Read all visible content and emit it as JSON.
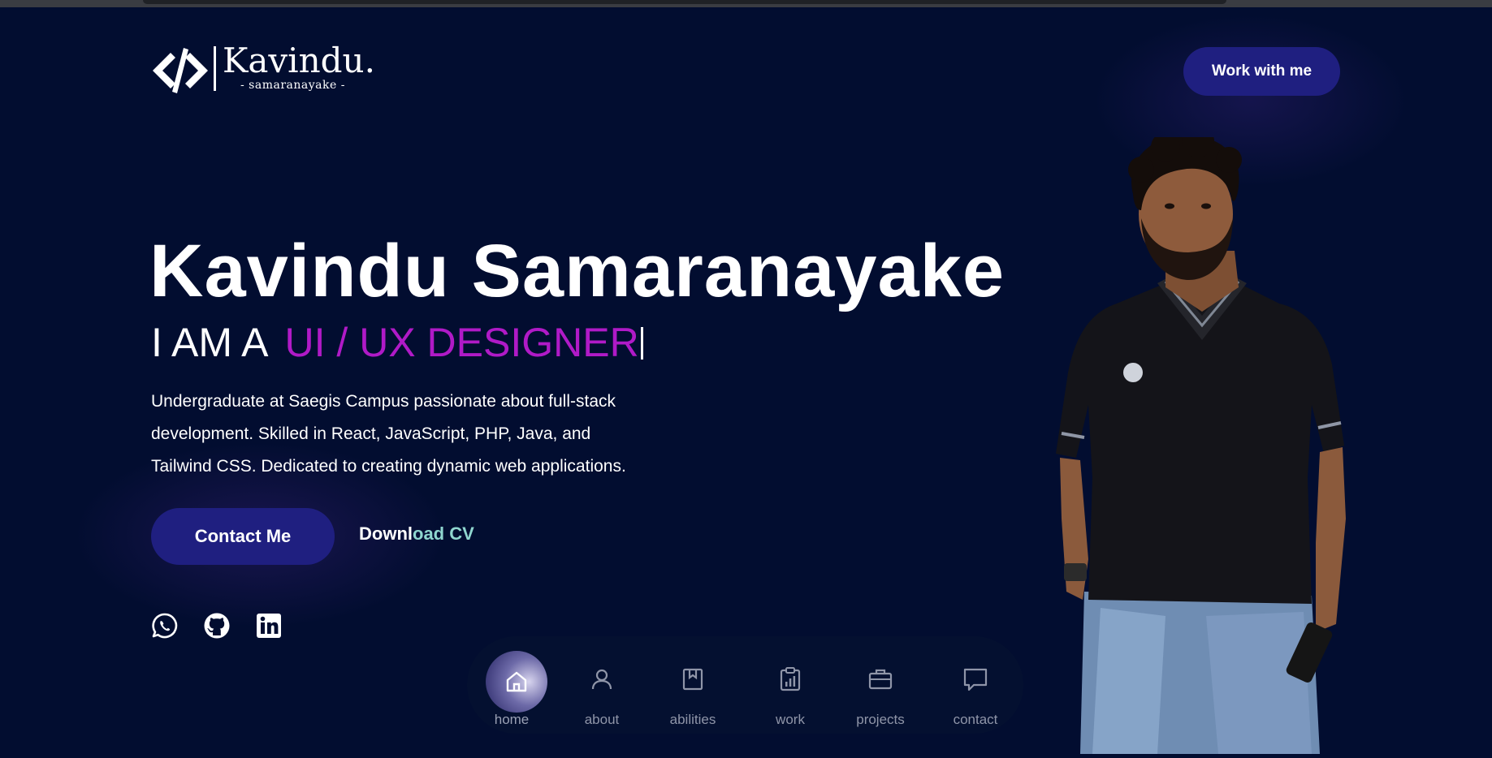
{
  "header": {
    "logo_name": "Kavindu.",
    "logo_sub": "- samaranayake -",
    "cta_label": "Work with me"
  },
  "hero": {
    "name": "Kavindu Samaranayake",
    "role_prefix": "I AM A",
    "role_value": "UI / UX DESIGNER",
    "bio": "Undergraduate at Saegis Campus passionate about full-stack development. Skilled in React, JavaScript, PHP, Java, and Tailwind CSS. Dedicated to creating dynamic web applications.",
    "contact_label": "Contact Me",
    "cv_label_a": "Downl",
    "cv_label_b": "oad CV"
  },
  "social": [
    {
      "icon": "whatsapp-icon"
    },
    {
      "icon": "github-icon"
    },
    {
      "icon": "linkedin-icon"
    }
  ],
  "nav": {
    "items": [
      {
        "label": "home",
        "icon": "home-icon",
        "active": true
      },
      {
        "label": "about",
        "icon": "user-icon",
        "active": false
      },
      {
        "label": "abilities",
        "icon": "bookmark-icon",
        "active": false
      },
      {
        "label": "work",
        "icon": "clipboard-chart-icon",
        "active": false
      },
      {
        "label": "projects",
        "icon": "briefcase-icon",
        "active": false
      },
      {
        "label": "contact",
        "icon": "chat-bubble-icon",
        "active": false
      }
    ]
  },
  "colors": {
    "background": "#020d30",
    "accent_button": "#1f1f80",
    "role_highlight": "#b01ac7",
    "cv_highlight": "#8fd6cf"
  }
}
